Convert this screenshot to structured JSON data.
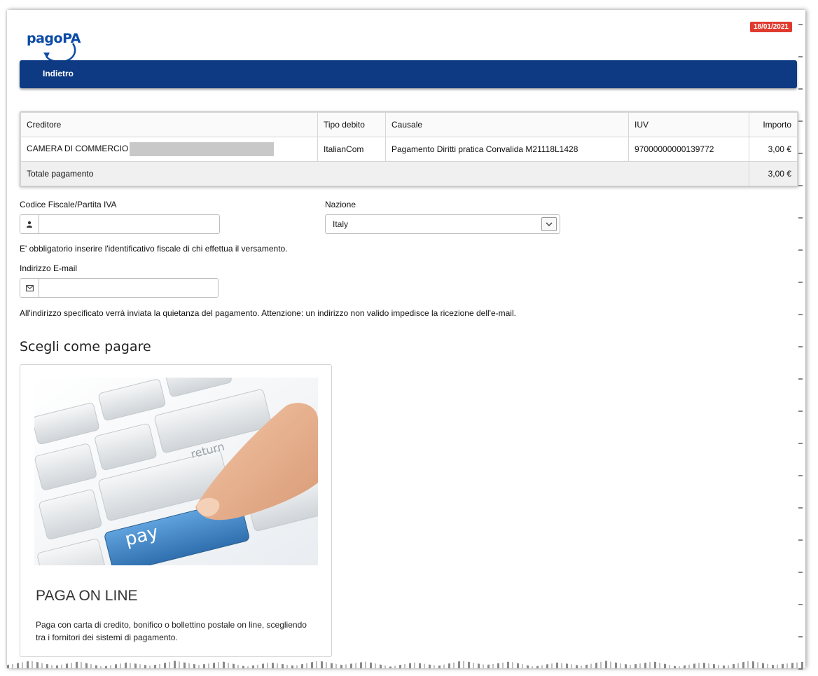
{
  "header": {
    "logo_text": "pagoPA",
    "date": "18/01/2021"
  },
  "nav": {
    "back_label": "Indietro"
  },
  "table": {
    "columns": [
      "Creditore",
      "Tipo debito",
      "Causale",
      "IUV",
      "Importo"
    ],
    "rows": [
      {
        "creditore": "CAMERA DI COMMERCIO",
        "tipo_debito": "ItalianCom",
        "causale": "Pagamento Diritti pratica Convalida M21118L1428",
        "iuv": "97000000000139772",
        "importo": "3,00 €"
      }
    ],
    "total_label": "Totale pagamento",
    "total_value": "3,00 €"
  },
  "form": {
    "cf_label": "Codice Fiscale/Partita IVA",
    "cf_value": "",
    "nazione_label": "Nazione",
    "nazione_value": "Italy",
    "cf_help": "E' obbligatorio inserire l'identificativo fiscale di chi effettua il versamento.",
    "email_label": "Indirizzo E-mail",
    "email_value": "",
    "email_help": "All'indirizzo specificato verrà inviata la quietanza del pagamento. Attenzione: un indirizzo non valido impedisce la ricezione dell'e-mail."
  },
  "payment": {
    "section_title": "Scegli come pagare",
    "card_key_label": "pay",
    "card_key_return": "return",
    "card_title": "PAGA ON LINE",
    "card_desc": "Paga con carta di credito, bonifico o bollettino postale on line, scegliendo tra i fornitori dei sistemi di pagamento."
  },
  "colors": {
    "navbar": "#0d3a83",
    "badge": "#e03a2f",
    "logo": "#0b4aa6",
    "pay_key": "#3b86c9"
  }
}
